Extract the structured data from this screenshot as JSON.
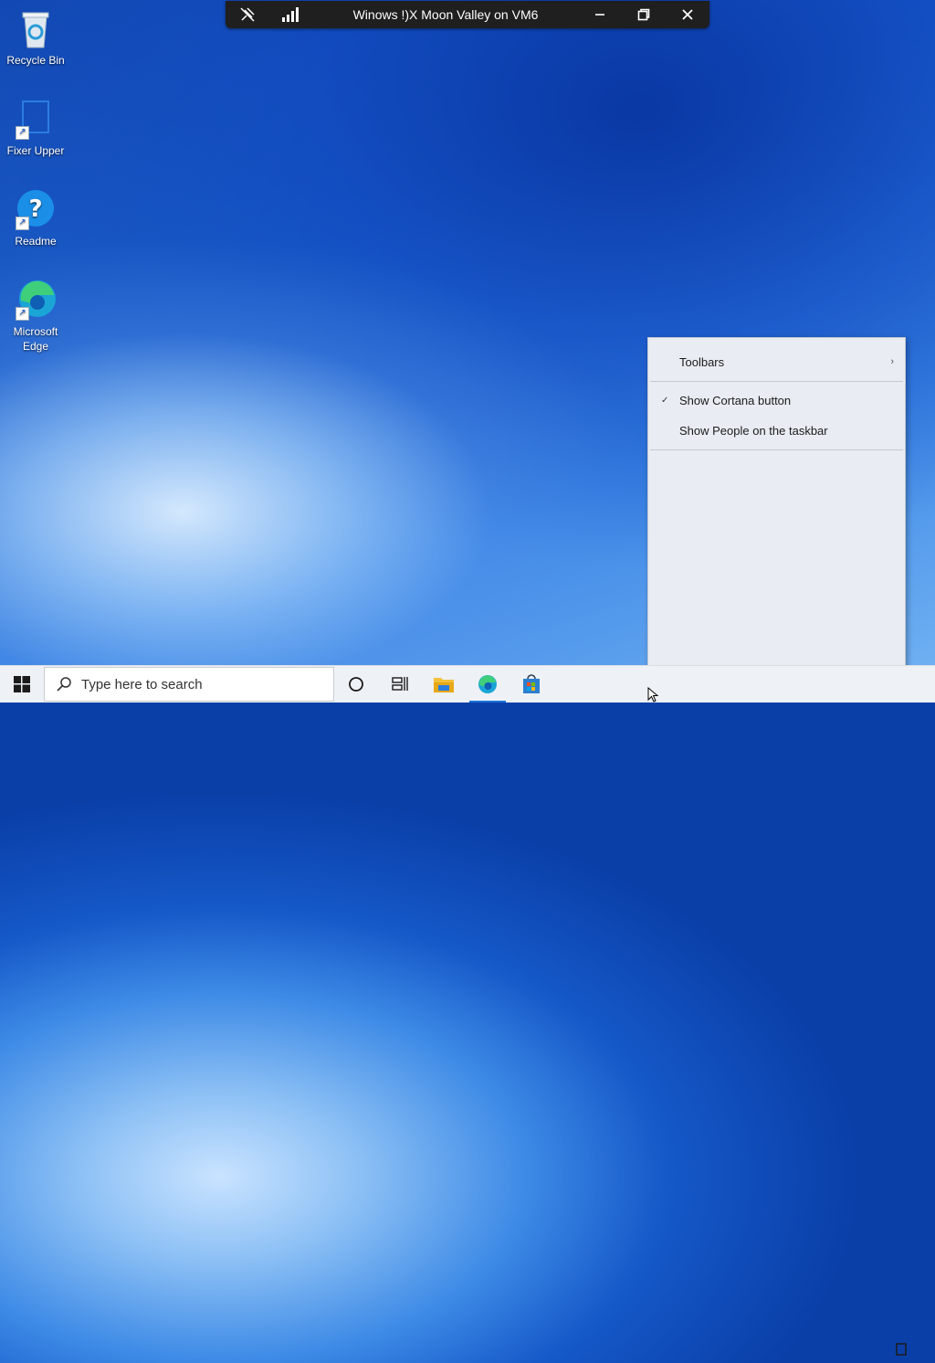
{
  "vm_bar": {
    "title": "Winows !)X Moon Valley on VM6",
    "icons": [
      "pin-off-icon",
      "signal-bars-icon",
      "minimize-icon",
      "restore-icon",
      "close-icon"
    ]
  },
  "desktop_icons": [
    {
      "label": "Recycle Bin",
      "icon": "recycle-bin-icon"
    },
    {
      "label": "Fixer Upper",
      "icon": "app-icon"
    },
    {
      "label": "Readme",
      "icon": "help-icon"
    },
    {
      "label": "Microsoft Edge",
      "icon": "edge-icon"
    }
  ],
  "taskbar": {
    "search_placeholder": "Type here to search",
    "buttons": [
      "start-icon",
      "cortana-icon",
      "task-view-icon",
      "file-explorer-icon",
      "edge-icon",
      "store-icon"
    ]
  },
  "context_menu": {
    "items": [
      {
        "label": "Toolbars",
        "has_submenu": true,
        "checked": false
      },
      {
        "label": "Show Cortana button",
        "has_submenu": false,
        "checked": true
      },
      {
        "label": "Show People on the taskbar",
        "has_submenu": false,
        "checked": false
      }
    ],
    "submenu_arrow": "›",
    "check_mark": "✓"
  },
  "colors": {
    "accent": "#1a73d9",
    "vmbar": "#1f1f1f"
  }
}
